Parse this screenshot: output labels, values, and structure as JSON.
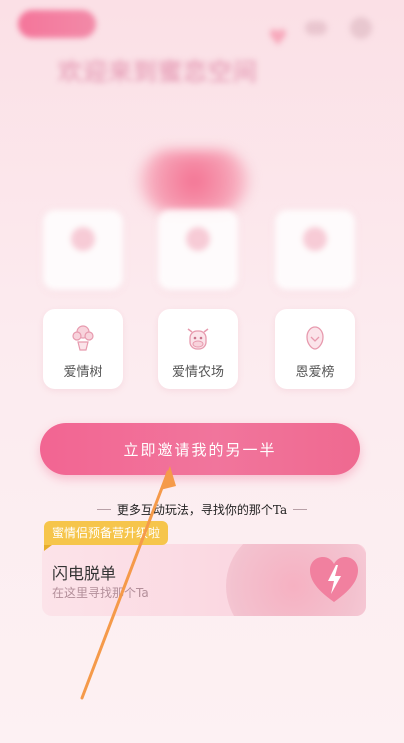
{
  "header": {
    "tag_label": "",
    "title": "欢迎来到蜜恋空间",
    "subtitle": ""
  },
  "grid": {
    "row1": [
      {
        "label": ""
      },
      {
        "label": ""
      },
      {
        "label": ""
      }
    ],
    "row2": [
      {
        "label": "爱情树",
        "icon": "flower-pot-icon"
      },
      {
        "label": "爱情农场",
        "icon": "cow-icon"
      },
      {
        "label": "恩爱榜",
        "icon": "ranking-icon"
      }
    ]
  },
  "invite_button": {
    "label": "立即邀请我的另一半"
  },
  "more_hint": "更多互动玩法，寻找你的那个Ta",
  "badge": "蜜情侣预备营升级啦",
  "flash": {
    "title": "闪电脱单",
    "subtitle": "在这里寻找那个Ta"
  },
  "colors": {
    "accent": "#f26592",
    "badge": "#f6c54b",
    "arrow": "#f59a4a"
  }
}
